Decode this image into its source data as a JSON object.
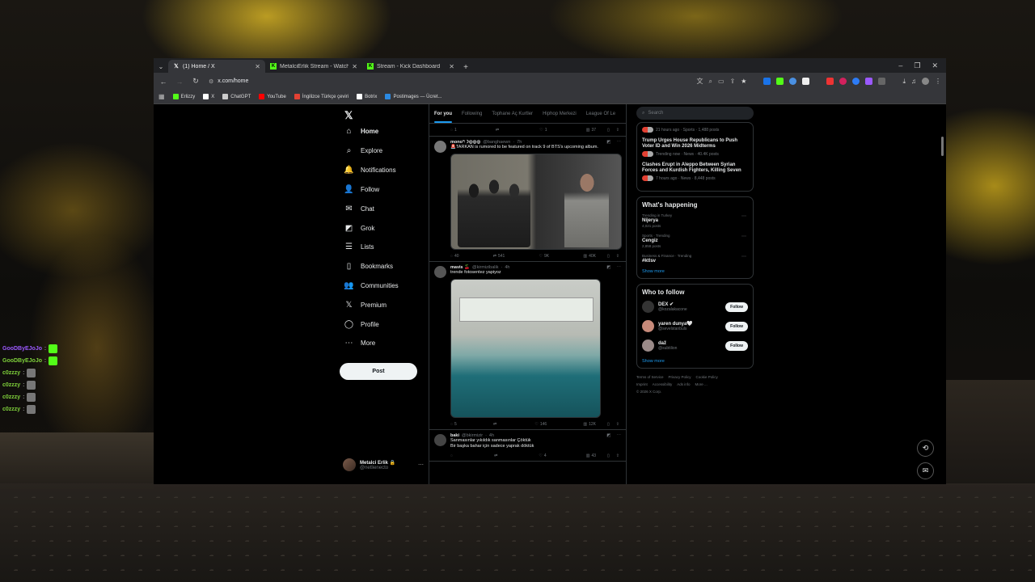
{
  "stream_chat": {
    "lines": [
      {
        "user": "GooDByEJoJo",
        "color": "#9b59ff"
      },
      {
        "user": "GooDByEJoJo",
        "color": "#7fd13b"
      },
      {
        "user": "c0zzzy",
        "color": "#7fd13b"
      },
      {
        "user": "c0zzzy",
        "color": "#7fd13b"
      },
      {
        "user": "c0zzzy",
        "color": "#7fd13b"
      },
      {
        "user": "c0zzzy",
        "color": "#7fd13b"
      }
    ]
  },
  "browser": {
    "tabs": [
      {
        "title": "(1) Home / X",
        "favicon": "x-logo",
        "active": true
      },
      {
        "title": "MetalciErlik Stream - Watch Li",
        "favicon": "kick-logo",
        "active": false
      },
      {
        "title": "Stream - Kick Dashboard",
        "favicon": "kick-logo",
        "active": false
      }
    ],
    "url": "x.com/home",
    "bookmarks": [
      {
        "label": "Erlizzy",
        "color": "#53fc18"
      },
      {
        "label": "X",
        "color": "#ffffff"
      },
      {
        "label": "ChatGPT",
        "color": "#cccccc"
      },
      {
        "label": "YouTube",
        "color": "#ff0000"
      },
      {
        "label": "İngilizce Türkçe çeviri",
        "color": "#e34133"
      },
      {
        "label": "Botrix",
        "color": "#ffffff"
      },
      {
        "label": "Postimages — Ücret...",
        "color": "#2b8ae2"
      }
    ]
  },
  "nav": {
    "items": [
      {
        "label": "Home",
        "icon": "home-icon",
        "glyph": "⌂"
      },
      {
        "label": "Explore",
        "icon": "search-icon",
        "glyph": "⌕"
      },
      {
        "label": "Notifications",
        "icon": "bell-icon",
        "glyph": "🔔"
      },
      {
        "label": "Follow",
        "icon": "person-plus-icon",
        "glyph": "👤"
      },
      {
        "label": "Chat",
        "icon": "mail-icon",
        "glyph": "✉"
      },
      {
        "label": "Grok",
        "icon": "grok-icon",
        "glyph": "◩"
      },
      {
        "label": "Lists",
        "icon": "list-icon",
        "glyph": "☰"
      },
      {
        "label": "Bookmarks",
        "icon": "bookmark-icon",
        "glyph": "▯"
      },
      {
        "label": "Communities",
        "icon": "people-icon",
        "glyph": "👥"
      },
      {
        "label": "Premium",
        "icon": "x-premium-icon",
        "glyph": "𝕏"
      },
      {
        "label": "Profile",
        "icon": "profile-icon",
        "glyph": "◯"
      },
      {
        "label": "More",
        "icon": "more-icon",
        "glyph": "⋯"
      }
    ],
    "post_label": "Post",
    "account": {
      "name": "Metalci Erlik 🔒",
      "handle": "@netlienecto"
    }
  },
  "feed": {
    "tabs": [
      "For you",
      "Following",
      "Tophane Aç Kurtler",
      "Hiphop Merkezi",
      "League Of Le"
    ],
    "top_actions": [
      "1",
      "",
      "1",
      "37"
    ],
    "tweets": [
      {
        "name": "mono°ᵎ☽◎◎◎",
        "handle": "@banghaewn",
        "time": "7h",
        "text": "🚨TARKAN is rumored to be featured on track 9 of BTS's upcoming album.",
        "actions": [
          "40",
          "541",
          "9K",
          "40K"
        ]
      },
      {
        "name": "mavis 🍒",
        "handle": "@kirmizibalik",
        "time": "4h",
        "text": "trende fotosentez yapiyoz",
        "actions": [
          "5",
          "",
          "146",
          "12K"
        ]
      },
      {
        "name": "baki",
        "handle": "@bkirmizir",
        "time": "4h",
        "text": "Sanmasınlar yıkıldık sanmasınlar Çöktük\nBir başka bahar için sadece yaprak döktük",
        "actions": [
          "",
          "",
          "4",
          "43"
        ]
      }
    ]
  },
  "sidebar": {
    "search_placeholder": "Search",
    "news": [
      {
        "meta": "21 hours ago · Sports · 1,488 posts"
      },
      {
        "title": "Trump Urges House Republicans to Push Voter ID and Win 2026 Midterms",
        "meta": "Trending now · News · 40.4K posts"
      },
      {
        "title": "Clashes Erupt in Aleppo Between Syrian Forces and Kurdish Fighters, Killing Seven",
        "meta": "7 hours ago · News · 8,448 posts"
      }
    ],
    "whats_happening_title": "What's happening",
    "trends": [
      {
        "context": "Trending in Turkey",
        "keyword": "Nijerya",
        "posts": "4,021 posts"
      },
      {
        "context": "Sports · Trending",
        "keyword": "Cengiz",
        "posts": "2,858 posts"
      },
      {
        "context": "Business & Finance · Trending",
        "keyword": "#ktlsv",
        "posts": ""
      }
    ],
    "show_more": "Show more",
    "who_to_follow_title": "Who to follow",
    "suggestions": [
      {
        "name": "DEX ✔",
        "handle": "@kozalakacone",
        "color": "#333333"
      },
      {
        "name": "yaren dunya🤍",
        "handle": "@sevelstanbuls",
        "color": "#c78a7a"
      },
      {
        "name": "daž",
        "handle": "@subtilion",
        "color": "#9a8a88"
      }
    ],
    "follow_label": "Follow",
    "footer": [
      "Terms of Service",
      "Privacy Policy",
      "Cookie Policy",
      "Imprint",
      "Accessibility",
      "Ads info",
      "More ...",
      "© 2026 X Corp."
    ]
  }
}
